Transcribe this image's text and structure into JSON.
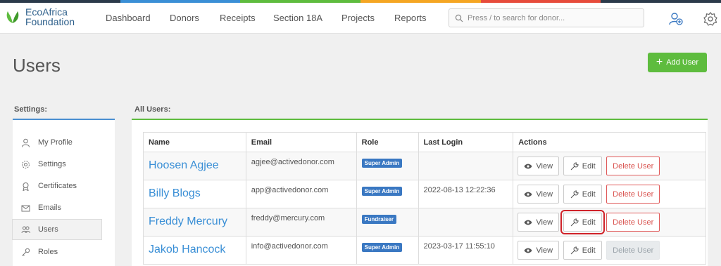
{
  "colors": {
    "stripe": [
      "#2b3a4a",
      "#3a8fd6",
      "#5ebc3e",
      "#f5a623",
      "#e74c3c",
      "#2b3a4a"
    ],
    "accent_green": "#5ebc3e",
    "link_blue": "#3a8fd6",
    "badge_blue": "#3a78c2",
    "delete_red": "#d9534f",
    "highlight_red": "#d0232a"
  },
  "brand": {
    "line1": "EcoAfrica",
    "line2": "Foundation",
    "logo_icon": "leaf-logo-icon"
  },
  "nav": {
    "links": [
      "Dashboard",
      "Donors",
      "Receipts",
      "Section 18A",
      "Projects",
      "Reports"
    ],
    "search_placeholder": "Press / to search for donor...",
    "icons": [
      "search-icon",
      "user-add-icon",
      "gear-icon"
    ]
  },
  "page": {
    "title": "Users",
    "add_button": "Add User"
  },
  "settings": {
    "label": "Settings:",
    "items": [
      {
        "label": "My Profile",
        "icon": "user-icon"
      },
      {
        "label": "Settings",
        "icon": "gear-icon"
      },
      {
        "label": "Certificates",
        "icon": "certificate-icon"
      },
      {
        "label": "Emails",
        "icon": "envelope-icon"
      },
      {
        "label": "Users",
        "icon": "users-icon",
        "active": true
      },
      {
        "label": "Roles",
        "icon": "key-icon"
      }
    ]
  },
  "users_table": {
    "label": "All Users:",
    "headers": [
      "Name",
      "Email",
      "Role",
      "Last Login",
      "Actions"
    ],
    "rows": [
      {
        "name": "Hoosen Agjee",
        "email": "agjee@activedonor.com",
        "role": "Super Admin",
        "last_login": "",
        "delete_enabled": true
      },
      {
        "name": "Billy Blogs",
        "email": "app@activedonor.com",
        "role": "Super Admin",
        "last_login": "2022-08-13 12:22:36",
        "delete_enabled": true
      },
      {
        "name": "Freddy Mercury",
        "email": "freddy@mercury.com",
        "role": "Fundraiser",
        "last_login": "",
        "delete_enabled": true,
        "edit_highlighted": true
      },
      {
        "name": "Jakob Hancock",
        "email": "info@activedonor.com",
        "role": "Super Admin",
        "last_login": "2023-03-17 11:55:10",
        "delete_enabled": false
      }
    ],
    "actions": {
      "view": "View",
      "edit": "Edit",
      "delete": "Delete User"
    }
  }
}
